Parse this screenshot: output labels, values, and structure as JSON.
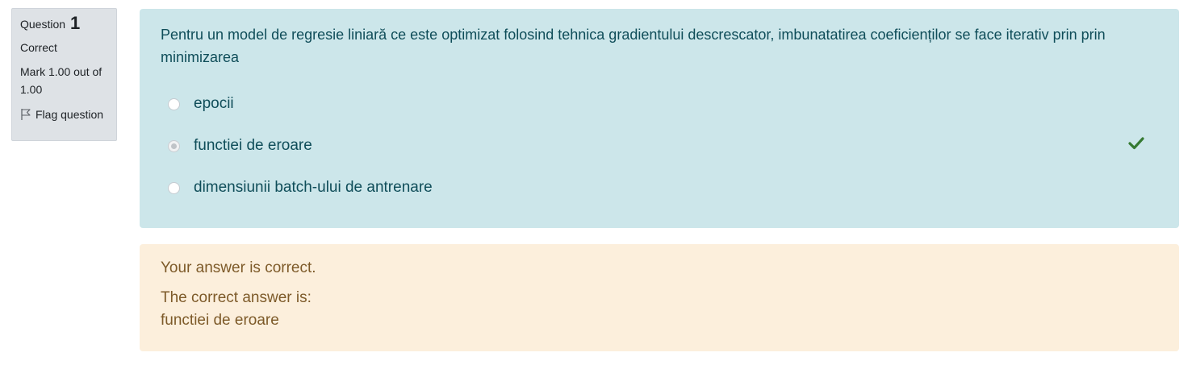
{
  "info": {
    "question_label": "Question",
    "question_number": "1",
    "state": "Correct",
    "grade": "Mark 1.00 out of 1.00",
    "flag_label": "Flag question"
  },
  "question": {
    "text": "Pentru un model de regresie liniară ce este optimizat folosind tehnica gradientului descrescator, imbunatatirea coeficienților se face iterativ prin prin minimizarea",
    "answers": [
      {
        "label": "epocii",
        "selected": false
      },
      {
        "label": "functiei de eroare",
        "selected": true,
        "correct": true
      },
      {
        "label": "dimensiunii batch-ului de antrenare",
        "selected": false
      }
    ]
  },
  "feedback": {
    "result": "Your answer is correct.",
    "correct_intro": "The correct answer is:",
    "correct_answer": "functiei de eroare"
  },
  "colors": {
    "content_bg": "#cce6ea",
    "feedback_bg": "#fcefdc",
    "info_bg": "#dee2e6",
    "check": "#357a32"
  }
}
